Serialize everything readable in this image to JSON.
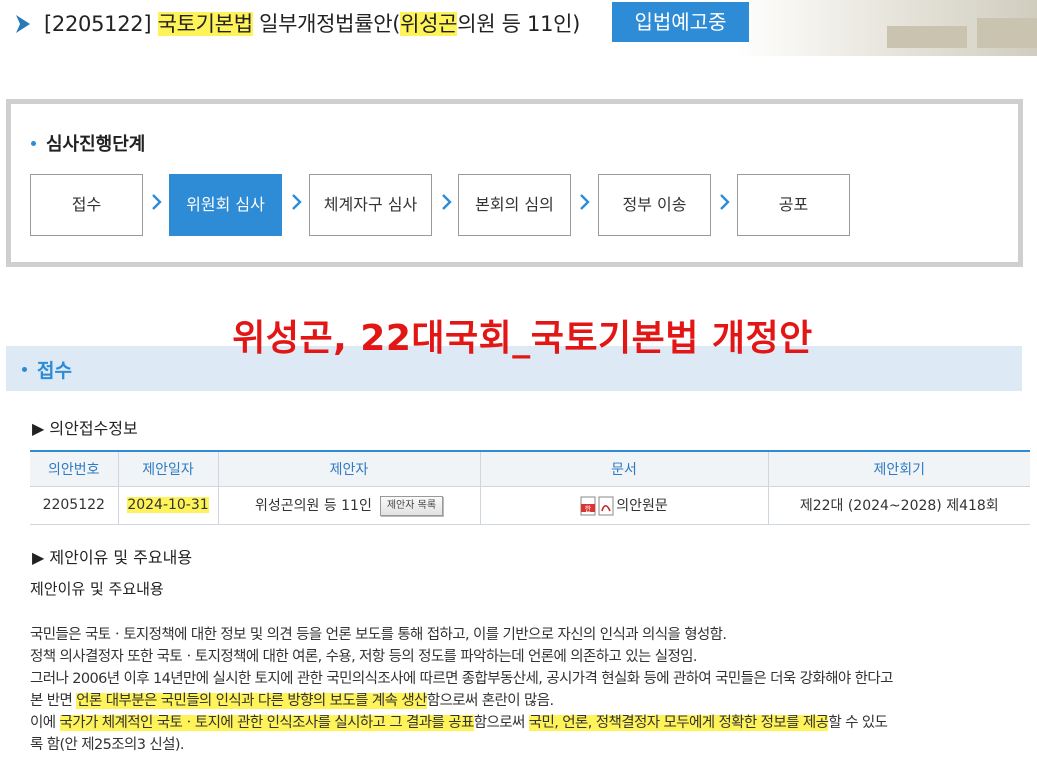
{
  "header": {
    "bill_number": "[2205122]",
    "title_hl1": "국토기본법",
    "title_mid": " 일부개정법률안(",
    "title_hl2": "위성곤",
    "title_end": "의원 등 11인)",
    "status_badge": "입법예고중"
  },
  "stages": {
    "heading": "심사진행단계",
    "steps": [
      {
        "label": "접수",
        "active": false
      },
      {
        "label": "위원회 심사",
        "active": true
      },
      {
        "label": "체계자구 심사",
        "active": false
      },
      {
        "label": "본회의 심의",
        "active": false
      },
      {
        "label": "정부 이송",
        "active": false
      },
      {
        "label": "공포",
        "active": false
      }
    ]
  },
  "overlay_title": "위성곤, 22대국회_국토기본법 개정안",
  "reception": {
    "section_title": "접수",
    "info_heading": "▶ 의안접수정보",
    "table": {
      "headers": [
        "의안번호",
        "제안일자",
        "제안자",
        "문서",
        "제안회기"
      ],
      "row": {
        "bill_no": "2205122",
        "date": "2024-10-31",
        "proposer": "위성곤의원 등 11인",
        "proposer_button": "제안자 목록",
        "document": "의안원문",
        "session": "제22대 (2024~2028) 제418회"
      }
    },
    "reason_heading": "▶ 제안이유 및 주요내용",
    "reason_subheading": "제안이유 및 주요내용",
    "body": {
      "line1": "국민들은 국토ㆍ토지정책에 대한 정보 및 의견 등을 언론 보도를 통해 접하고, 이를 기반으로 자신의 인식과 의식을 형성함.",
      "line2": "정책 의사결정자 또한 국토ㆍ토지정책에 대한 여론, 수용, 저항 등의 정도를 파악하는데 언론에 의존하고 있는 실정임.",
      "line3": "그러나 2006년 이후 14년만에 실시한 토지에 관한 국민의식조사에 따르면 종합부동산세, 공시가격 현실화 등에 관하여 국민들은 더욱 강화해야 한다고",
      "line4_a": "본 반면 ",
      "line4_hl": "언론 대부분은 국민들의 인식과 다른 방향의 보도를 계속 생산",
      "line4_b": "함으로써 혼란이 많음.",
      "line5_a": "이에 ",
      "line5_hl1": "국가가 체계적인 국토ㆍ토지에 관한 인식조사를 실시하고 그 결과를 공표",
      "line5_b": "함으로써 ",
      "line5_hl2": "국민, 언론, 정책결정자 모두에게 정확한 정보를 제공",
      "line5_c": "할 수 있도",
      "line6": "록 함(안 제25조의3 신설)."
    }
  },
  "colors": {
    "accent": "#2e8bd6",
    "highlight": "#fff35a",
    "overlay_red": "#e31616"
  }
}
